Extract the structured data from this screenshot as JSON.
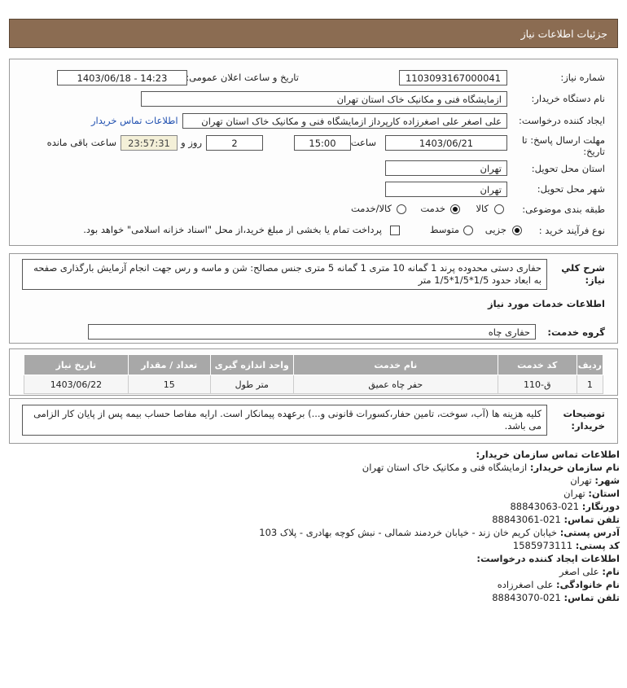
{
  "header": {
    "title": "جزئیات اطلاعات نیاز"
  },
  "form": {
    "need_number_label": "شماره نیاز:",
    "need_number": "1103093167000041",
    "announce_label": "تاریخ و ساعت اعلان عمومی:",
    "announce_value": "1403/06/18 - 14:23",
    "buyer_org_label": "نام دستگاه خریدار:",
    "buyer_org": "ازمایشگاه فنی و مکانیک خاک استان تهران",
    "creator_label": "ایجاد کننده درخواست:",
    "creator": "علی اصغر علی اصغرزاده کارپرداز ازمایشگاه فنی و مکانیک خاک استان تهران",
    "contact_link": "اطلاعات تماس خریدار",
    "deadline_label_1": "مهلت ارسال پاسخ: تا",
    "deadline_label_2": "تاریخ:",
    "deadline_date": "1403/06/21",
    "time_label": "ساعت",
    "deadline_time": "15:00",
    "days": "2",
    "days_label": "روز و",
    "timer": "23:57:31",
    "remaining_label": "ساعت باقی مانده",
    "province_label": "استان محل تحویل:",
    "province": "تهران",
    "city_label": "شهر محل تحویل:",
    "city": "تهران",
    "category_label": "طبقه بندی موضوعی:",
    "category_options": [
      "کالا",
      "خدمت",
      "کالا/خدمت"
    ],
    "category_selected": "خدمت",
    "process_label": "نوع فرآیند خرید :",
    "process_options": [
      "جزیی",
      "متوسط"
    ],
    "process_selected": "جزیی",
    "treasury_text": "پرداخت تمام یا بخشی از مبلغ خرید،از محل \"اسناد خزانه اسلامی\" خواهد بود."
  },
  "description": {
    "label_1": "شرح کلي",
    "label_2": "نياز:",
    "text": "حفاری دستی محدوده پرند 1 گمانه 10 متری 1 گمانه 5 متری جنس مصالح: شن و ماسه و رس جهت انجام آزمایش بارگذاری صفحه به ابعاد حدود 1/5*1/5*1/5 متر"
  },
  "services": {
    "section_title": "اطلاعات خدمات مورد نیاز",
    "group_label": "گروه خدمت:",
    "group_value": "حفاری چاه",
    "columns": [
      "ردیف",
      "کد خدمت",
      "نام خدمت",
      "واحد اندازه گیری",
      "تعداد / مقدار",
      "تاریخ نیاز"
    ],
    "rows": [
      [
        "1",
        "ق-110",
        "حفر چاه عمیق",
        "متر طول",
        "15",
        "1403/06/22"
      ]
    ]
  },
  "buyer_notes": {
    "label_1": "توضیحات",
    "label_2": "خریدار:",
    "text": "کلیه هزینه ها (آب، سوخت، تامین حفار،کسورات قانونی و...) برعهده پیمانکار است. ارایه مفاصا حساب بیمه پس از پایان کار الزامی می باشد."
  },
  "contact": {
    "title": "اطلاعات تماس سازمان خریدار:",
    "org_label": "نام سازمان خریدار:",
    "org_value": "ازمایشگاه فنی و مکانیک خاک استان تهران",
    "city_label": "شهر:",
    "city_value": "تهران",
    "province_label": "استان:",
    "province_value": "تهران",
    "fax_label": "دورنگار:",
    "fax_value": "021-88843063",
    "phone_label": "تلفن تماس:",
    "phone_value": "021-88843061",
    "address_label": "آدرس پستی:",
    "address_value": "خیابان کریم خان زند - خیابان خردمند شمالی - نبش کوچه بهادری - پلاک 103",
    "postal_label": "کد پستی:",
    "postal_value": "1585973111",
    "creator_title": "اطلاعات ایجاد کننده درخواست:",
    "first_name_label": "نام:",
    "first_name_value": "علی اصغر",
    "last_name_label": "نام خانوادگی:",
    "last_name_value": "علی اصغرزاده",
    "creator_phone_label": "تلفن تماس:",
    "creator_phone_value": "021-88843070"
  }
}
